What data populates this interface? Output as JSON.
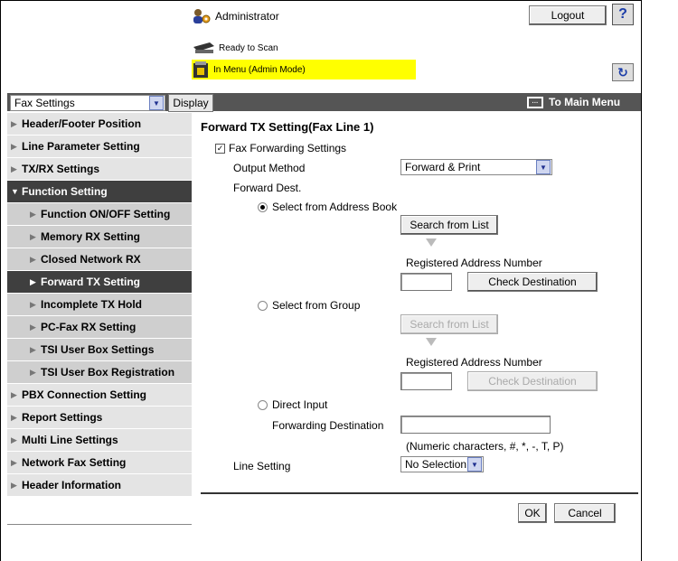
{
  "header": {
    "user": "Administrator",
    "logout_label": "Logout",
    "help_label": "?",
    "status_ready": "Ready to Scan",
    "status_menu": "In Menu (Admin Mode)",
    "colors": {
      "status_highlight": "#ffff00",
      "toolbar": "#555555",
      "active_item": "#3f3f3f"
    }
  },
  "toolbar": {
    "category_value": "Fax Settings",
    "display_label": "Display",
    "main_menu_label": "To Main Menu"
  },
  "sidebar": {
    "items": [
      {
        "label": "Header/Footer Position",
        "level": 1
      },
      {
        "label": "Line Parameter Setting",
        "level": 1
      },
      {
        "label": "TX/RX Settings",
        "level": 1
      },
      {
        "label": "Function Setting",
        "level": 1,
        "expanded": true
      },
      {
        "label": "Function ON/OFF Setting",
        "level": 2
      },
      {
        "label": "Memory RX Setting",
        "level": 2
      },
      {
        "label": "Closed Network RX",
        "level": 2
      },
      {
        "label": "Forward TX Setting",
        "level": 2,
        "selected": true
      },
      {
        "label": "Incomplete TX Hold",
        "level": 2
      },
      {
        "label": "PC-Fax RX Setting",
        "level": 2
      },
      {
        "label": "TSI User Box Settings",
        "level": 2
      },
      {
        "label": "TSI User Box Registration",
        "level": 2
      },
      {
        "label": "PBX Connection Setting",
        "level": 1
      },
      {
        "label": "Report Settings",
        "level": 1
      },
      {
        "label": "Multi Line Settings",
        "level": 1
      },
      {
        "label": "Network Fax Setting",
        "level": 1
      },
      {
        "label": "Header Information",
        "level": 1
      }
    ]
  },
  "form": {
    "title": "Forward TX Setting(Fax Line 1)",
    "fax_forwarding_label": "Fax Forwarding Settings",
    "fax_forwarding_checked": true,
    "output_method_label": "Output Method",
    "output_method_value": "Forward & Print",
    "forward_dest_label": "Forward Dest.",
    "opt_address_book": "Select from Address Book",
    "search_from_list": "Search from List",
    "registered_address_number": "Registered Address Number",
    "check_destination": "Check Destination",
    "opt_group": "Select from Group",
    "opt_direct": "Direct Input",
    "forwarding_destination_label": "Forwarding Destination",
    "direct_hint": "(Numeric characters, #, *, -, T, P)",
    "line_setting_label": "Line Setting",
    "line_setting_value": "No Selection",
    "selected_dest": "address_book",
    "ok_label": "OK",
    "cancel_label": "Cancel"
  }
}
